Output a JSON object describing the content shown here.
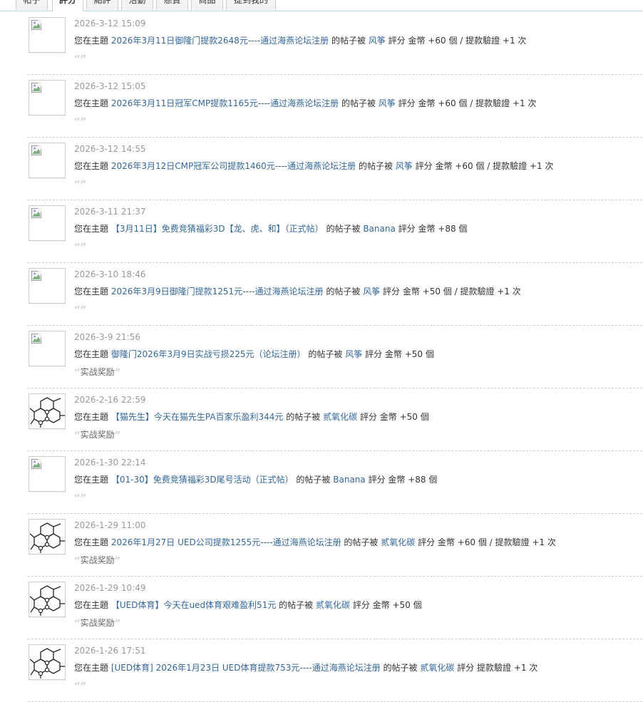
{
  "tabs": [
    {
      "label": "帖子",
      "active": false
    },
    {
      "label": "評分",
      "active": true
    },
    {
      "label": "點評",
      "active": false
    },
    {
      "label": "活動",
      "active": false
    },
    {
      "label": "懸賞",
      "active": false
    },
    {
      "label": "商品",
      "active": false
    },
    {
      "label": "提到我的",
      "active": false
    }
  ],
  "notices": [
    {
      "time": "2026-3-12 15:09",
      "avatar": "broken-image",
      "prefix": "您在主題",
      "topic": "2026年3月11日御隆门提款2648元----通过海燕论坛注册",
      "mid": "的帖子被",
      "user": "风筝",
      "tail": "評分 金幣 +60 個 / 提款驗證 +1 次",
      "comment": ""
    },
    {
      "time": "2026-3-12 15:05",
      "avatar": "broken-image",
      "prefix": "您在主題",
      "topic": "2026年3月11日冠军CMP提款1165元----通过海燕论坛注册",
      "mid": "的帖子被",
      "user": "风筝",
      "tail": "評分 金幣 +60 個 / 提款驗證 +1 次",
      "comment": ""
    },
    {
      "time": "2026-3-12 14:55",
      "avatar": "broken-image",
      "prefix": "您在主題",
      "topic": "2026年3月12日CMP冠军公司提款1460元----通过海燕论坛注册",
      "mid": "的帖子被",
      "user": "风筝",
      "tail": "評分 金幣 +60 個 / 提款驗證 +1 次",
      "comment": ""
    },
    {
      "time": "2026-3-11 21:37",
      "avatar": "broken-image",
      "prefix": "您在主題",
      "topic": "【3月11日】免费竞猜福彩3D【龙、虎、和】（正式帖）",
      "mid": "的帖子被",
      "user": "Banana",
      "tail": "評分 金幣 +88 個",
      "comment": ""
    },
    {
      "time": "2026-3-10 18:46",
      "avatar": "broken-image",
      "prefix": "您在主題",
      "topic": "2026年3月9日御隆门提款1251元----通过海燕论坛注册",
      "mid": "的帖子被",
      "user": "风筝",
      "tail": "評分 金幣 +50 個 / 提款驗證 +1 次",
      "comment": ""
    },
    {
      "time": "2026-3-9 21:56",
      "avatar": "broken-image",
      "prefix": "您在主題",
      "topic": "御隆门2026年3月9日实战亏损225元（论坛注册）",
      "mid": "的帖子被",
      "user": "风筝",
      "tail": "評分 金幣 +50 個",
      "comment": "实战奖励"
    },
    {
      "time": "2026-2-16 22:59",
      "avatar": "molecule",
      "prefix": "您在主題",
      "topic": "【猫先生】今天在猫先生PA百家乐盈利344元",
      "mid": "的帖子被",
      "user": "贰氧化碳",
      "tail": "評分 金幣 +50 個",
      "comment": "实战奖励"
    },
    {
      "time": "2026-1-30 22:14",
      "avatar": "broken-image",
      "prefix": "您在主題",
      "topic": "【01-30】免费竞猜福彩3D尾号活动（正式帖）",
      "mid": "的帖子被",
      "user": "Banana",
      "tail": "評分 金幣 +88 個",
      "comment": ""
    },
    {
      "time": "2026-1-29 11:00",
      "avatar": "molecule",
      "prefix": "您在主題",
      "topic": "2026年1月27日 UED公司提款1255元----通过海燕论坛注册",
      "mid": "的帖子被",
      "user": "贰氧化碳",
      "tail": "評分 金幣 +60 個 / 提款驗證 +1 次",
      "comment": "实战奖励"
    },
    {
      "time": "2026-1-29 10:49",
      "avatar": "molecule",
      "prefix": "您在主題",
      "topic": "【UED体育】今天在ued体育艰难盈利51元",
      "mid": "的帖子被",
      "user": "贰氧化碳",
      "tail": "評分 金幣 +50 個",
      "comment": "实战奖励"
    },
    {
      "time": "2026-1-26 17:51",
      "avatar": "molecule",
      "prefix": "您在主題",
      "topic": "[UED体育] 2026年1月23日 UED体育提款753元----通过海燕论坛注册",
      "mid": "的帖子被",
      "user": "贰氧化碳",
      "tail": "評分 提款驗證 +1 次",
      "comment": ""
    }
  ]
}
